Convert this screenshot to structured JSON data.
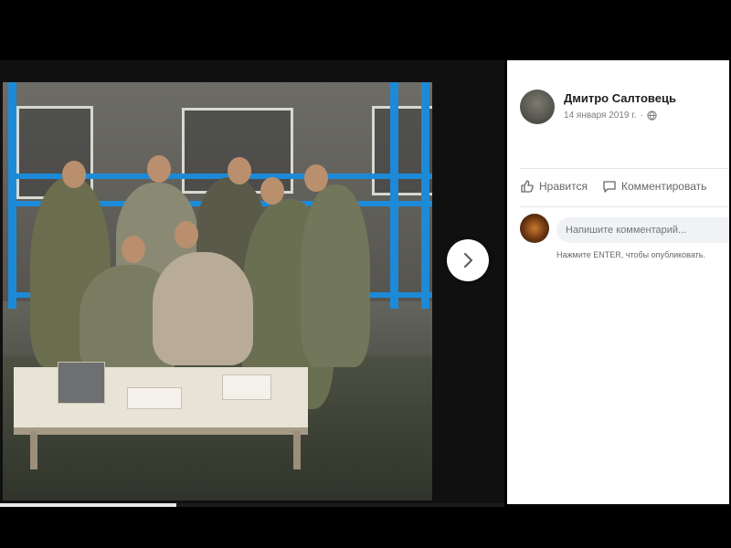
{
  "post": {
    "author": "Дмитро Салтовець",
    "date": "14 января 2019 г.",
    "date_separator": "·"
  },
  "actions": {
    "like": "Нравится",
    "comment": "Комментировать"
  },
  "comment": {
    "placeholder": "Напишите комментарий...",
    "hint": "Нажмите ENTER, чтобы опубликовать."
  },
  "viewer": {
    "next_icon": "chevron-right-icon",
    "progress_fraction": 0.35
  },
  "colors": {
    "rail_blue": "#1d8ad8",
    "panel_bg": "#ffffff"
  }
}
